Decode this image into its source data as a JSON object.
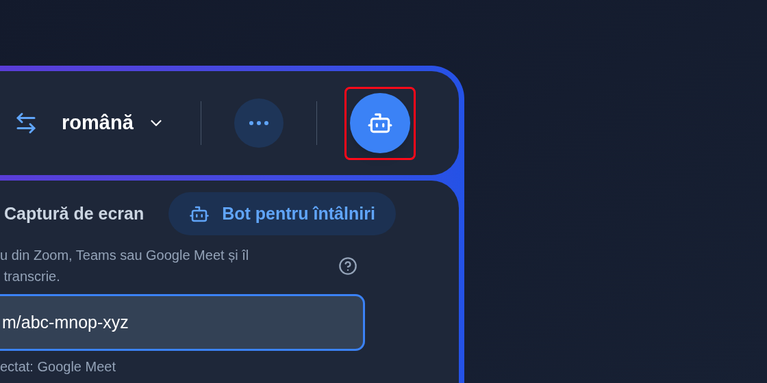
{
  "toolbar": {
    "language": "română",
    "bot_button": {
      "highlighted": true
    }
  },
  "mode_tabs": [
    {
      "label": "Captură de ecran",
      "selected": false
    },
    {
      "label": "Bot pentru întâlniri",
      "selected": true
    }
  ],
  "description": [
    "u din Zoom, Teams sau Google Meet și îl",
    " transcrie."
  ],
  "meeting_link": {
    "value": "m/abc-mnop-xyz"
  },
  "detected": "ectat: Google Meet"
}
